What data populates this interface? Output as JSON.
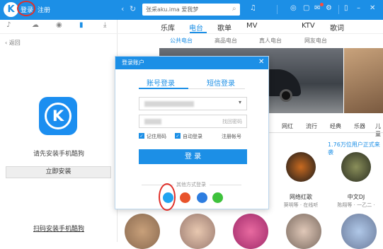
{
  "topbar": {
    "logo": "K",
    "login": "登录",
    "register": "注册",
    "search_placeholder": "张采aku.ima 爱我梦"
  },
  "left_panel": {
    "back": "返回",
    "connect_prompt": "请先安装手机酷狗",
    "install_button": "立即安装",
    "scan_link": "扫码安装手机酷狗",
    "logo_letter": "K"
  },
  "main_tabs": [
    "乐库",
    "电台",
    "歌单",
    "MV",
    "KTV",
    "歌词"
  ],
  "sub_tabs": [
    "公共电台",
    "高品电台",
    "真人电台",
    "网友电台"
  ],
  "categories": [
    "网红",
    "流行",
    "经典",
    "乐器",
    "儿童"
  ],
  "count_text": "1.76万位用户正式来袭",
  "radio_items": [
    {
      "title": "网络红歌",
      "sub": "葵明等 · 在线听"
    },
    {
      "title": "中文DJ",
      "sub": "陈翔等 · 一乙二 ·"
    }
  ],
  "modal": {
    "title": "登录账户",
    "close": "✕",
    "tab_account": "账号登录",
    "tab_sms": "短信登录",
    "forgot_password": "找回密码",
    "remember": "记住用码",
    "auto_login": "自动登录",
    "register_account": "注册帐号",
    "login_button": "登 录",
    "other_methods": "其他方式登录"
  }
}
